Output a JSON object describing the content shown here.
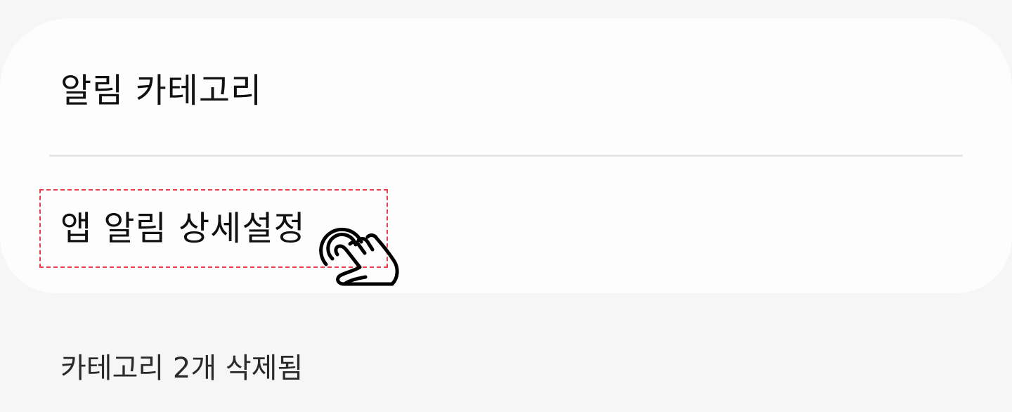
{
  "settings": {
    "notification_categories_label": "알림 카테고리",
    "app_notification_detail_label": "앱 알림 상세설정",
    "deleted_categories_text": "카테고리 2개 삭제됨"
  },
  "icons": {
    "tap": "tap-hand-icon"
  },
  "colors": {
    "highlight": "#e8414b",
    "card_background": "#fdfdfd",
    "page_background": "#f6f6f6",
    "divider": "#e6e6e6"
  }
}
